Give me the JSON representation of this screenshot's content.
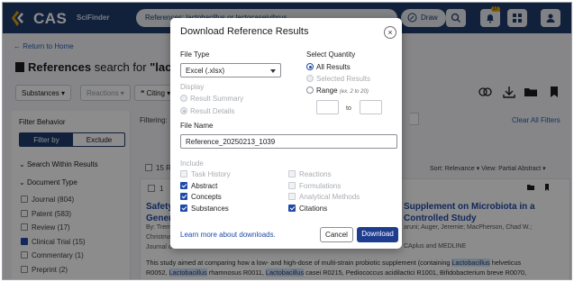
{
  "app": {
    "logo": "CAS",
    "logo_sub": "SciFinder",
    "search_query": "References: lactobacillus or lactocaseivibrus...",
    "draw_label": "Draw",
    "notification_count": "17"
  },
  "page": {
    "return_link": "← Return to Home",
    "heading_bold": "References",
    "heading_mid": " search for ",
    "heading_query": "\"lactob",
    "actions": {
      "substances": "Substances ▾",
      "reactions": "Reactions ▾",
      "citing": "❝ Citing ▾"
    }
  },
  "filters": {
    "title": "Filter Behavior",
    "filter_by": "Filter by",
    "exclude": "Exclude",
    "search_within": "Search Within Results",
    "doc_type": "Document Type",
    "items": [
      {
        "label": "Journal (804)",
        "checked": false
      },
      {
        "label": "Patent (583)",
        "checked": false
      },
      {
        "label": "Review (17)",
        "checked": false
      },
      {
        "label": "Clinical Trial (15)",
        "checked": true
      },
      {
        "label": "Commentary (1)",
        "checked": false
      },
      {
        "label": "Preprint (2)",
        "checked": false
      }
    ]
  },
  "results": {
    "filtering_label": "Filtering:",
    "clear_all": "Clear All Filters",
    "count": "15 Re",
    "sort": "Sort: Relevance ▾   View: Partial Abstract ▾",
    "card_num": "1",
    "title_left_1": "Safety",
    "title_left_2": "Genera",
    "title_right_1": "Supplement on Microbiota in a",
    "title_right_2": "Controlled Study",
    "by_line": "By: Tremi",
    "meta_right": "aruni; Auger, Jeremie; MacPherson, Chad W.;",
    "christmas": "Christmas",
    "journal": "Journal o",
    "sources": "CAplus and MEDLINE",
    "abstract_1a": "This study aimed at comparing how a low- and high-dose of multi-strain probiotic supplement (containing ",
    "abstract_1b": "Lactobacillus",
    "abstract_1c": " helveticus",
    "abstract_2a": "R0052, ",
    "abstract_2b": "Lactobacillus",
    "abstract_2c": " rhamnosus R0011, ",
    "abstract_2d": "Lactobacillus",
    "abstract_2e": " casei R0215, Pediococcus acidilactici R1001, Bifidobacterium breve R0070,"
  },
  "modal": {
    "title": "Download Reference Results",
    "close": "×",
    "file_type_label": "File Type",
    "file_type_value": "Excel (.xlsx)",
    "display_label": "Display",
    "display_options": [
      {
        "label": "Result Summary",
        "selected": false
      },
      {
        "label": "Result Details",
        "selected": true
      }
    ],
    "quantity_label": "Select Quantity",
    "quantity_options": {
      "all": "All Results",
      "selected": "Selected Results",
      "range": "Range",
      "range_example": "(ex. 2 to 20)"
    },
    "range_to": "to",
    "file_name_label": "File Name",
    "file_name_value": "Reference_20250213_1039",
    "include_label": "Include",
    "include_left": [
      {
        "label": "Task History",
        "checked": false,
        "enabled": false
      },
      {
        "label": "Abstract",
        "checked": true,
        "enabled": true
      },
      {
        "label": "Concepts",
        "checked": true,
        "enabled": true
      },
      {
        "label": "Substances",
        "checked": true,
        "enabled": true
      }
    ],
    "include_right": [
      {
        "label": "Reactions",
        "checked": false,
        "enabled": false
      },
      {
        "label": "Formulations",
        "checked": false,
        "enabled": false
      },
      {
        "label": "Analytical Methods",
        "checked": false,
        "enabled": false
      },
      {
        "label": "Citations",
        "checked": true,
        "enabled": true
      }
    ],
    "learn_more": "Learn more about downloads.",
    "cancel": "Cancel",
    "download": "Download"
  },
  "colors": {
    "brand_navy": "#1f3d6d",
    "primary_button": "#1f3d8f",
    "link": "#1f4aa8",
    "highlight": "#cfe3f7",
    "notification": "#e8a300"
  }
}
